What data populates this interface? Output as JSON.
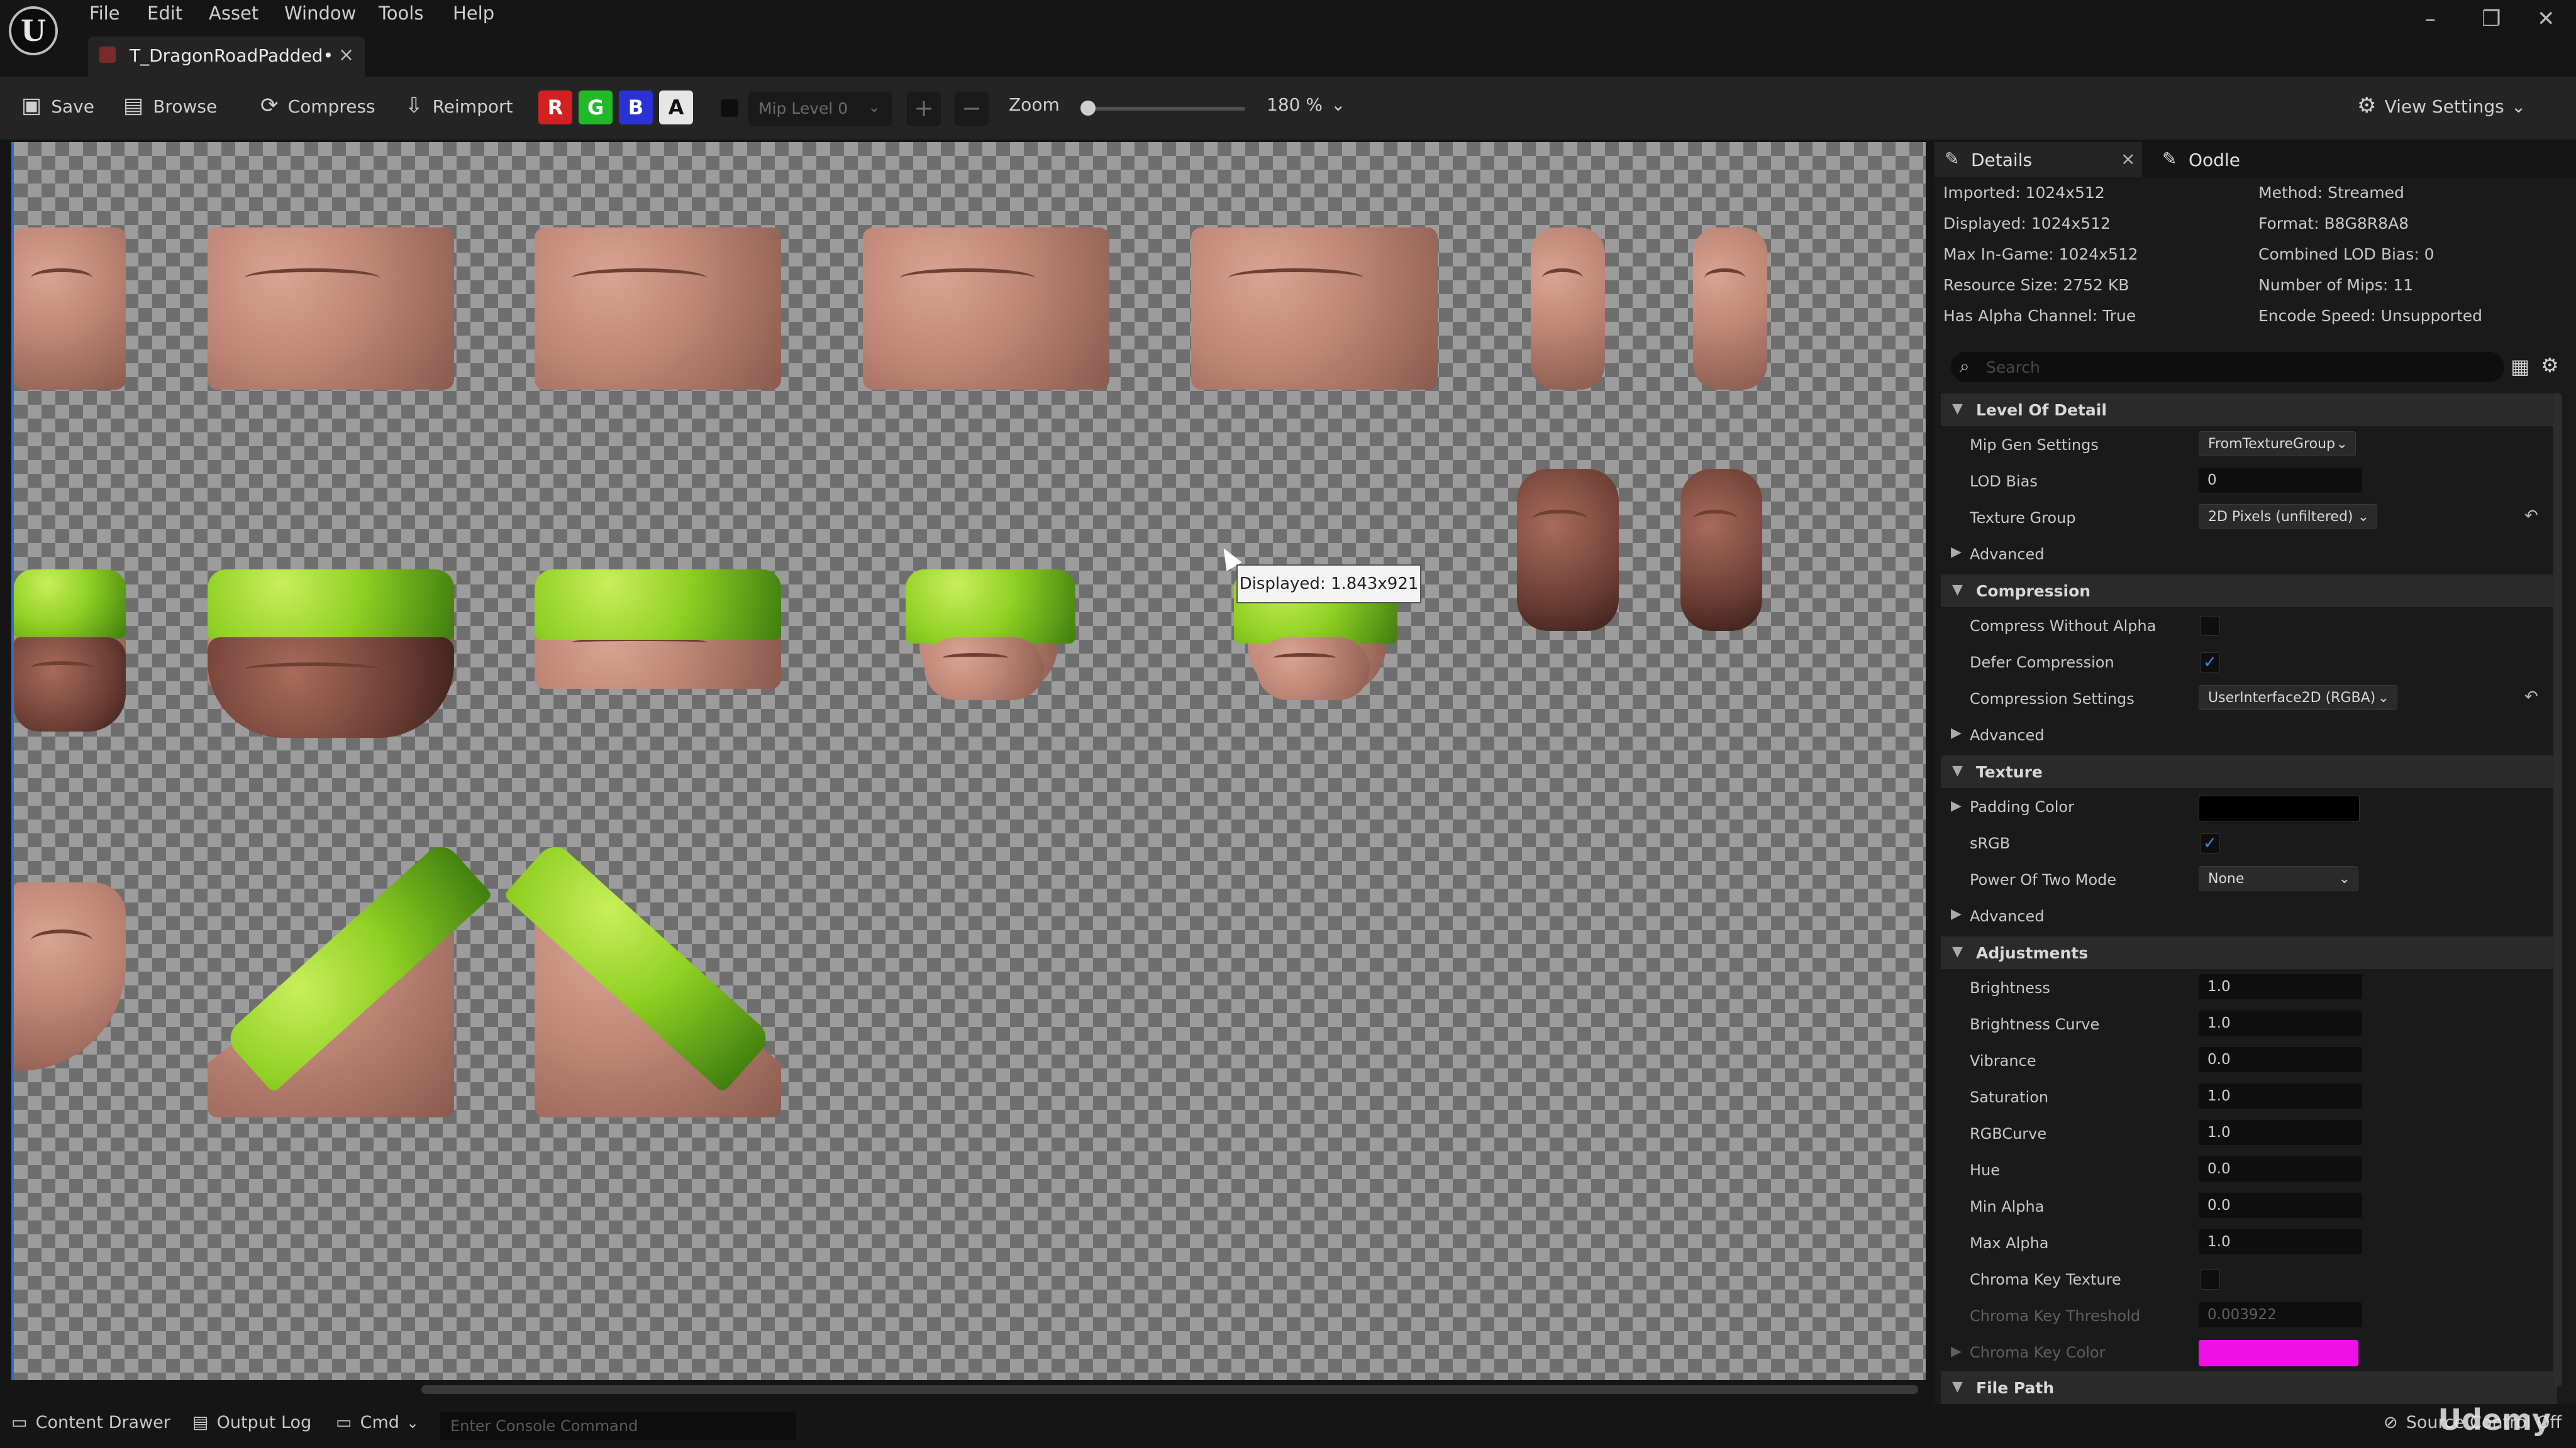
{
  "menu": [
    "File",
    "Edit",
    "Asset",
    "Window",
    "Tools",
    "Help"
  ],
  "tab": {
    "label": "T_DragonRoadPadded•",
    "close": "×"
  },
  "window_controls": [
    "–",
    "❐",
    "✕"
  ],
  "toolbar": {
    "save": "Save",
    "browse": "Browse",
    "compress": "Compress",
    "reimport": "Reimport",
    "channels": [
      {
        "label": "R",
        "color": "#d32020"
      },
      {
        "label": "G",
        "color": "#21b92a"
      },
      {
        "label": "B",
        "color": "#2a32d6"
      },
      {
        "label": "A",
        "color": "#e6e6e6"
      }
    ],
    "mip_level": "Mip Level 0",
    "zoom_label": "Zoom",
    "zoom_value": "180 %",
    "view_settings": "View Settings"
  },
  "viewport": {
    "tooltip": "Displayed: 1.843x921"
  },
  "details": {
    "tab_details": "Details",
    "tab_details_close": "×",
    "tab_oodle": "Oodle",
    "info_left": [
      "Imported: 1024x512",
      "Displayed: 1024x512",
      "Max In-Game: 1024x512",
      "Resource Size: 2752 KB",
      "Has Alpha Channel: True"
    ],
    "info_right": [
      "Method: Streamed",
      "Format: B8G8R8A8",
      "Combined LOD Bias: 0",
      "Number of Mips: 11",
      "Encode Speed: Unsupported"
    ],
    "search_placeholder": "Search",
    "sections": {
      "lod": "Level Of Detail",
      "compression": "Compression",
      "texture": "Texture",
      "adjustments": "Adjustments",
      "file_path": "File Path"
    },
    "lod": {
      "mip_gen_label": "Mip Gen Settings",
      "mip_gen_value": "FromTextureGroup",
      "lod_bias_label": "LOD Bias",
      "lod_bias_value": "0",
      "texture_group_label": "Texture Group",
      "texture_group_value": "2D Pixels (unfiltered)",
      "advanced": "Advanced"
    },
    "compression": {
      "without_alpha_label": "Compress Without Alpha",
      "without_alpha_checked": false,
      "defer_label": "Defer Compression",
      "defer_checked": true,
      "settings_label": "Compression Settings",
      "settings_value": "UserInterface2D (RGBA)",
      "advanced": "Advanced"
    },
    "texture": {
      "padding_color_label": "Padding Color",
      "padding_color": "#000000",
      "srgb_label": "sRGB",
      "srgb_checked": true,
      "pot_label": "Power Of Two Mode",
      "pot_value": "None",
      "advanced": "Advanced"
    },
    "adjustments": [
      {
        "label": "Brightness",
        "value": "1.0"
      },
      {
        "label": "Brightness Curve",
        "value": "1.0"
      },
      {
        "label": "Vibrance",
        "value": "0.0"
      },
      {
        "label": "Saturation",
        "value": "1.0"
      },
      {
        "label": "RGBCurve",
        "value": "1.0"
      },
      {
        "label": "Hue",
        "value": "0.0"
      },
      {
        "label": "Min Alpha",
        "value": "0.0"
      },
      {
        "label": "Max Alpha",
        "value": "1.0"
      }
    ],
    "chroma": {
      "texture_label": "Chroma Key Texture",
      "texture_checked": false,
      "threshold_label": "Chroma Key Threshold",
      "threshold_value": "0.003922",
      "color_label": "Chroma Key Color",
      "color": "#f010e8"
    }
  },
  "statusbar": {
    "content_drawer": "Content Drawer",
    "output_log": "Output Log",
    "cmd": "Cmd",
    "console_placeholder": "Enter Console Command",
    "source_control": "Source Control Off"
  },
  "watermark": "Udemy"
}
